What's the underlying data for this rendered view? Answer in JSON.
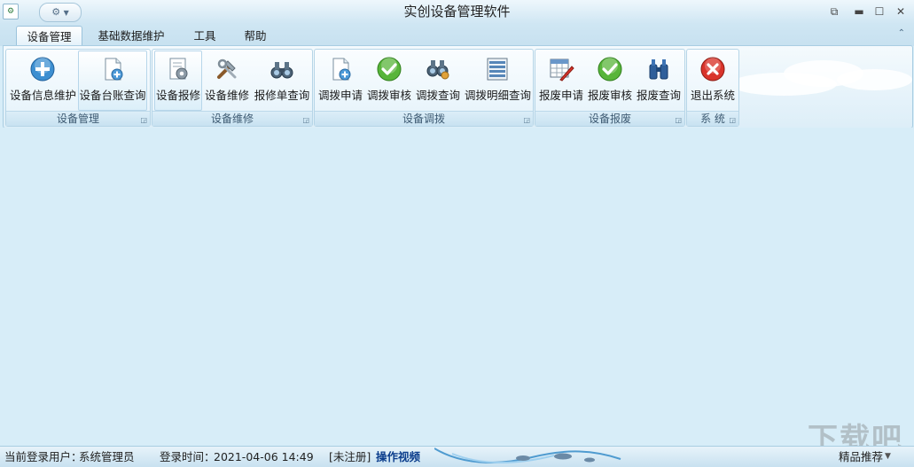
{
  "window": {
    "title": "实创设备管理软件"
  },
  "tabs": [
    "设备管理",
    "基础数据维护",
    "工具",
    "帮助"
  ],
  "groups": [
    {
      "label": "设备管理",
      "buttons": [
        {
          "label": "设备信息维护",
          "icon": "add-circle-icon"
        },
        {
          "label": "设备台账查询",
          "icon": "document-add-icon"
        }
      ]
    },
    {
      "label": "设备维修",
      "buttons": [
        {
          "label": "设备报修",
          "icon": "notebook-gear-icon"
        },
        {
          "label": "设备维修",
          "icon": "tools-icon"
        },
        {
          "label": "报修单查询",
          "icon": "binoculars-icon"
        }
      ]
    },
    {
      "label": "设备调拨",
      "buttons": [
        {
          "label": "调拨申请",
          "icon": "document-add-icon"
        },
        {
          "label": "调拨审核",
          "icon": "checkmark-icon"
        },
        {
          "label": "调拨查询",
          "icon": "binoculars-person-icon"
        },
        {
          "label": "调拨明细查询",
          "icon": "list-icon"
        }
      ]
    },
    {
      "label": "设备报废",
      "buttons": [
        {
          "label": "报废申请",
          "icon": "sheet-pencil-icon"
        },
        {
          "label": "报废审核",
          "icon": "checkmark-icon"
        },
        {
          "label": "报废查询",
          "icon": "binoculars-blue-icon"
        }
      ]
    },
    {
      "label": "系 统",
      "buttons": [
        {
          "label": "退出系统",
          "icon": "close-red-icon"
        }
      ]
    }
  ],
  "status": {
    "user_label": "当前登录用户：",
    "user_value": "系统管理员",
    "time_label": "登录时间：",
    "time_value": "2021-04-06 14:49",
    "register": "[未注册]",
    "video": "操作视频",
    "recommend": "精品推荐"
  },
  "colors": {
    "accent": "#3d8fd1",
    "background": "#d7edf8",
    "green": "#58b53a",
    "red": "#d9342b"
  }
}
